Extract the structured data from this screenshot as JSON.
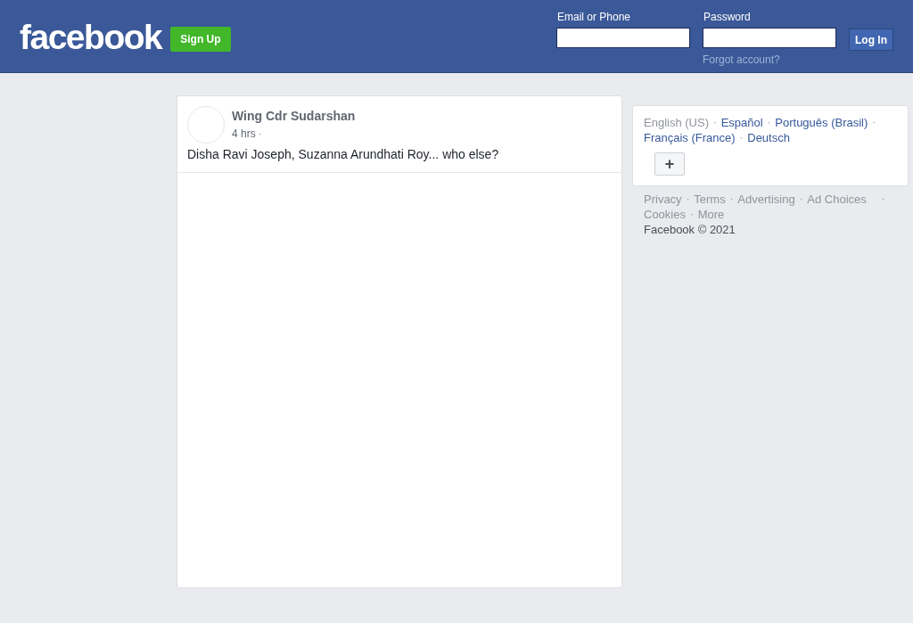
{
  "header": {
    "logo": "facebook",
    "signup_button": "Sign Up",
    "email": {
      "label": "Email or Phone"
    },
    "password": {
      "label": "Password"
    },
    "login_button": "Log In",
    "forgot_link": "Forgot account?"
  },
  "post": {
    "author": "Wing Cdr Sudarshan",
    "time": "4 hrs",
    "time_sep": "·",
    "text": "Disha Ravi Joseph, Suzanna Arundhati Roy... who else?"
  },
  "languages": {
    "items": [
      {
        "label": "English (US)",
        "selected": true,
        "sep": "·"
      },
      {
        "label": "Español",
        "selected": false,
        "sep": "·"
      },
      {
        "label": "Português (Brasil)",
        "selected": false,
        "sep": "·"
      },
      {
        "label": "Français (France)",
        "selected": false,
        "sep": "·"
      },
      {
        "label": "Deutsch",
        "selected": false
      }
    ],
    "more_button": "+"
  },
  "footer": {
    "links": [
      {
        "label": "Privacy",
        "sep": "·"
      },
      {
        "label": "Terms",
        "sep": "·"
      },
      {
        "label": "Advertising",
        "sep": "·"
      },
      {
        "label": "Ad Choices",
        "sep": "·"
      },
      {
        "label": "Cookies",
        "sep": "·"
      },
      {
        "label": "More"
      }
    ],
    "copyright": "Facebook © 2021"
  }
}
